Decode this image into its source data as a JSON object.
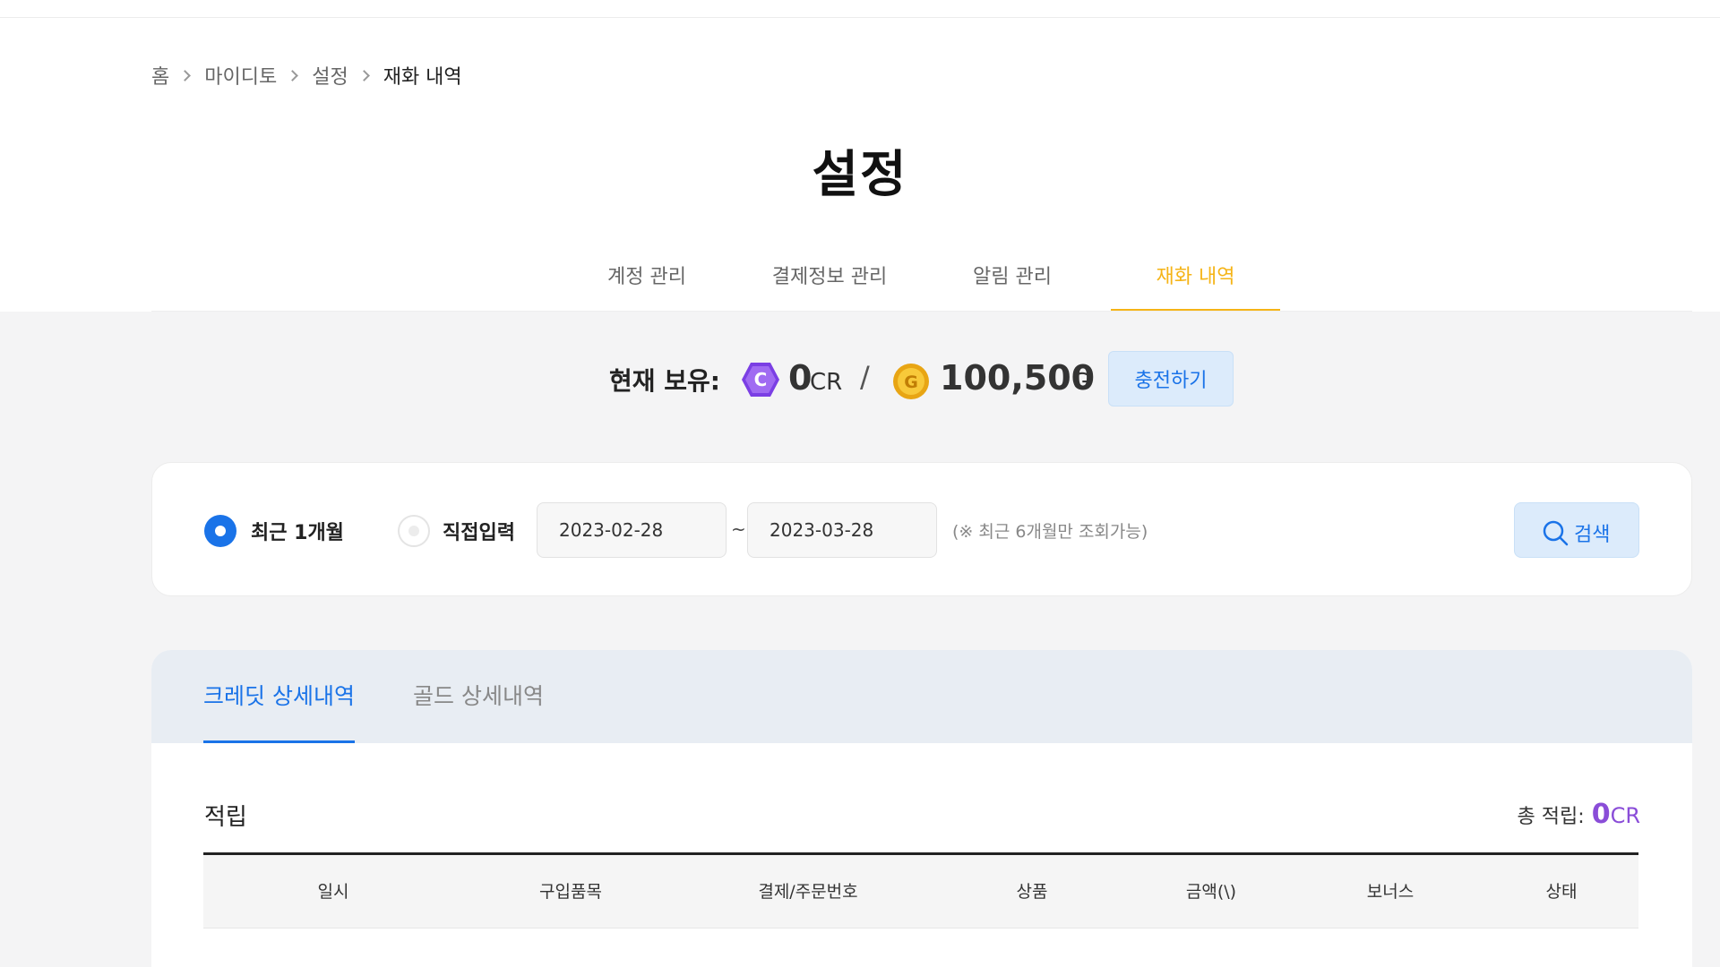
{
  "breadcrumb": {
    "home": "홈",
    "mydito": "마이디토",
    "settings": "설정",
    "current": "재화 내역"
  },
  "page_title": "설정",
  "tabs": {
    "account": "계정 관리",
    "payment": "결제정보 관리",
    "notifications": "알림 관리",
    "currency": "재화 내역"
  },
  "balance": {
    "label": "현재 보유:",
    "credit_value": "0",
    "credit_unit": "CR",
    "credit_icon_letter": "C",
    "slash": "/",
    "gold_value": "100,500",
    "gold_unit": "G",
    "gold_icon_letter": "G",
    "charge_label": "충전하기"
  },
  "filter": {
    "recent_label": "최근 1개월",
    "custom_label": "직접입력",
    "start_date": "2023-02-28",
    "end_date": "2023-03-28",
    "tilde": "~",
    "notice": "(※ 최근 6개월만 조회가능)",
    "search_label": "검색"
  },
  "history": {
    "tab_credit": "크레딧 상세내역",
    "tab_gold": "골드 상세내역",
    "section_title": "적립",
    "total_label": "총 적립:",
    "total_value": "0",
    "total_unit": "CR",
    "columns": [
      "일시",
      "구입품목",
      "결제/주문번호",
      "상품",
      "금액(\\)",
      "보너스",
      "상태"
    ]
  },
  "colors": {
    "accent_gold": "#f5b417",
    "accent_blue": "#1a73e8",
    "credit_purple": "#8a4dd8"
  },
  "icons": {
    "credit": "credit-coin-icon",
    "gold": "gold-coin-icon",
    "search": "search-icon",
    "breadcrumb_separator": "chevron-right-icon"
  }
}
